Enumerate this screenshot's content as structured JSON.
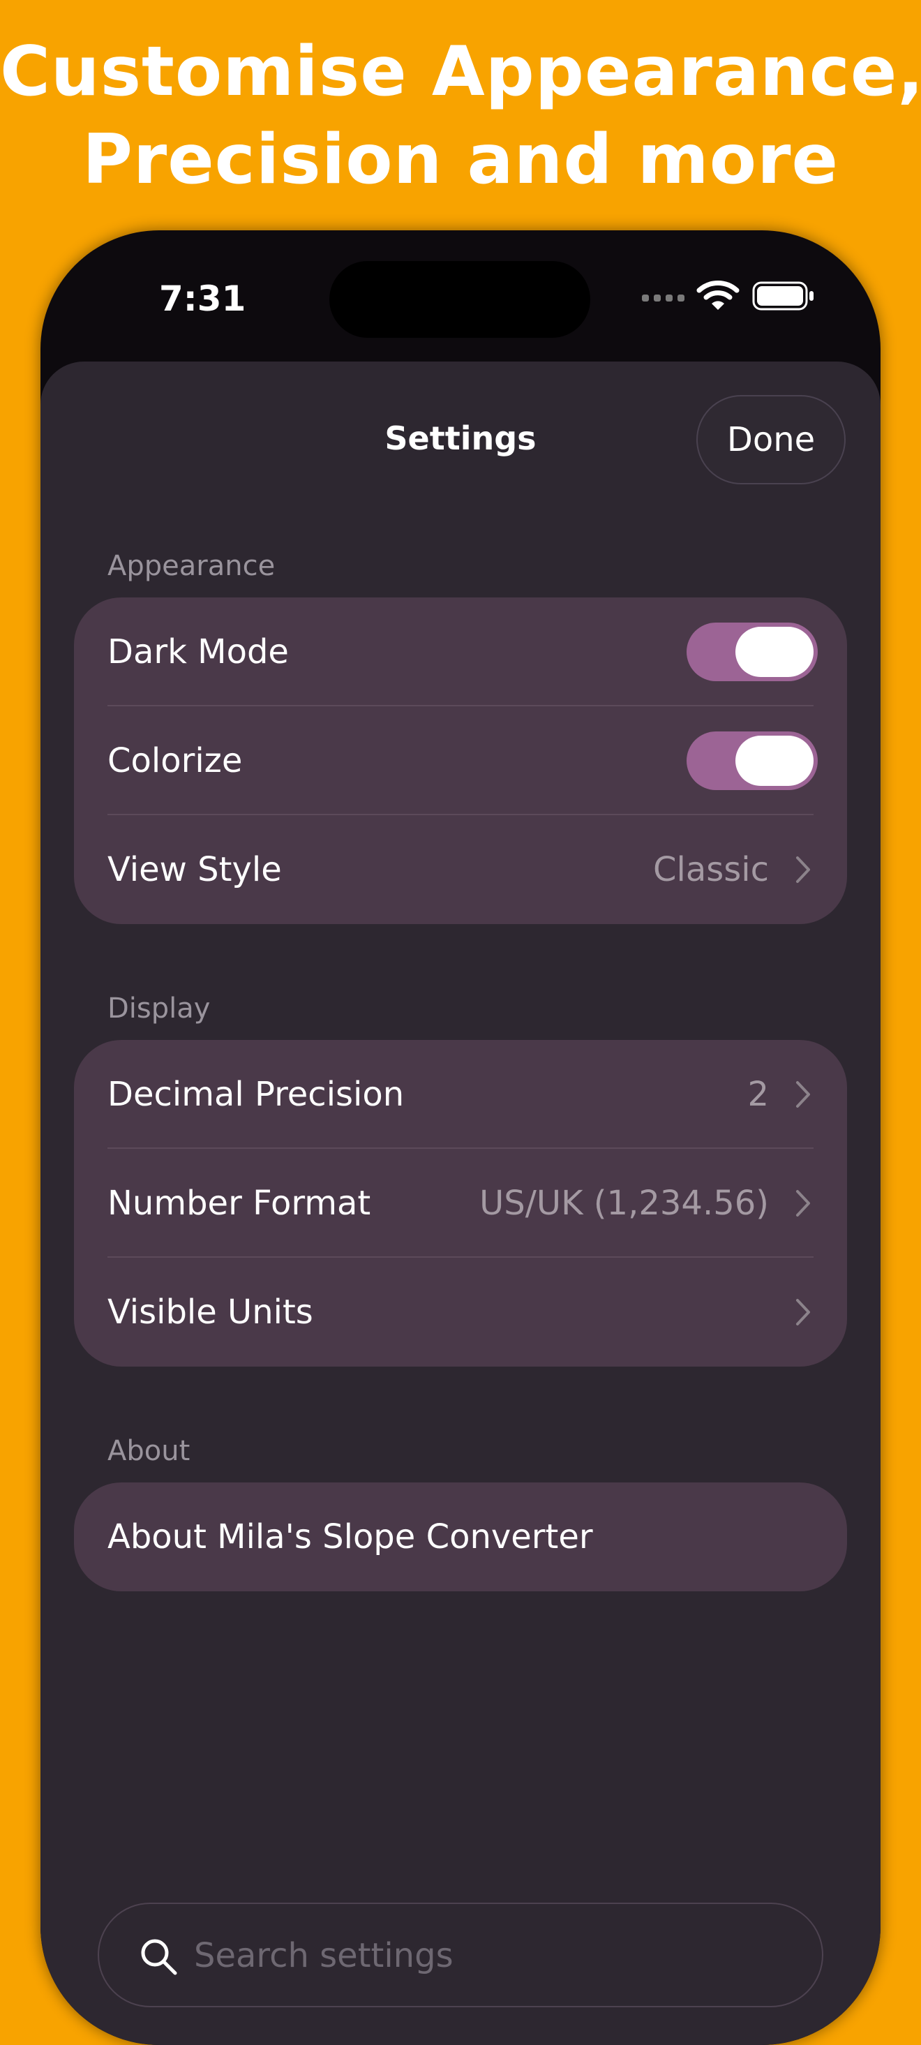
{
  "headline": {
    "line1": "Customise Appearance,",
    "line2": "Precision and more"
  },
  "status_bar": {
    "time": "7:31",
    "icons": [
      "signal-icon",
      "wifi-icon",
      "battery-icon"
    ]
  },
  "header": {
    "title": "Settings",
    "done_label": "Done"
  },
  "sections": {
    "appearance": {
      "label": "Appearance",
      "rows": [
        {
          "label": "Dark Mode",
          "toggle_on": true
        },
        {
          "label": "Colorize",
          "toggle_on": true
        },
        {
          "label": "View Style",
          "value": "Classic"
        }
      ]
    },
    "display": {
      "label": "Display",
      "rows": [
        {
          "label": "Decimal Precision",
          "value": "2"
        },
        {
          "label": "Number Format",
          "value": "US/UK (1,234.56)"
        },
        {
          "label": "Visible Units",
          "value": ""
        }
      ]
    },
    "about": {
      "label": "About",
      "rows": [
        {
          "label": "About Mila's Slope Converter"
        }
      ]
    }
  },
  "search": {
    "placeholder": "Search settings"
  },
  "colors": {
    "background": "#F8A300",
    "sheet": "#2D2730",
    "group": "#4A3949",
    "toggle_on": "#9C6495"
  }
}
